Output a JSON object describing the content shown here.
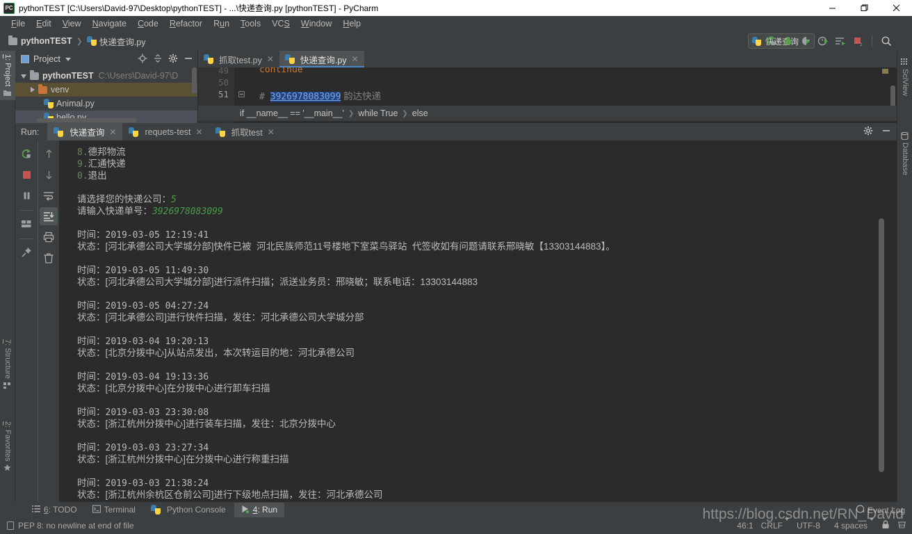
{
  "window": {
    "title": "pythonTEST [C:\\Users\\David-97\\Desktop\\pythonTEST] - ...\\快递查询.py [pythonTEST] - PyCharm",
    "logo_text": "PC",
    "minimize": "—",
    "maximize": "❐",
    "close": "✕"
  },
  "menubar": {
    "items": [
      {
        "label": "File"
      },
      {
        "label": "Edit"
      },
      {
        "label": "View"
      },
      {
        "label": "Navigate"
      },
      {
        "label": "Code"
      },
      {
        "label": "Refactor"
      },
      {
        "label": "Run"
      },
      {
        "label": "Tools"
      },
      {
        "label": "VCS"
      },
      {
        "label": "Window"
      },
      {
        "label": "Help"
      }
    ]
  },
  "navbar": {
    "project_name": "pythonTEST",
    "separator": "❯",
    "file_name": "快递查询.py"
  },
  "run_config": {
    "name": "快递查询",
    "toolbar_icons": [
      "run-icon",
      "debug-icon",
      "coverage-icon",
      "profile-icon",
      "run-with-console-icon",
      "stop-icon",
      "search-everywhere-icon"
    ]
  },
  "left_strip": {
    "tabs": [
      {
        "label": "1: Project",
        "icon": "folder-icon",
        "active": true
      },
      {
        "label": "7: Structure",
        "icon": "structure-icon",
        "active": false
      },
      {
        "label": "2: Favorites",
        "icon": "star-icon",
        "active": false
      }
    ]
  },
  "right_strip": {
    "tabs": [
      {
        "label": "SciView",
        "icon": "grid-icon"
      },
      {
        "label": "Database",
        "icon": "database-icon"
      }
    ]
  },
  "project_window": {
    "title": "Project",
    "actions": [
      "locate-icon",
      "collapse-all-icon",
      "gear-icon",
      "hide-icon"
    ],
    "tree": [
      {
        "label": "pythonTEST",
        "path": "C:\\Users\\David-97\\D",
        "icon": "folder-icon",
        "depth": 0,
        "expanded": true,
        "bold": true,
        "selected": false
      },
      {
        "label": "venv",
        "path": "",
        "icon": "orange-folder-icon",
        "depth": 1,
        "expanded": false,
        "bold": false,
        "selected": true
      },
      {
        "label": "Animal.py",
        "path": "",
        "icon": "python-file-icon",
        "depth": 2,
        "expanded": null,
        "bold": false,
        "selected": false
      },
      {
        "label": "hello.py",
        "path": "",
        "icon": "python-file-icon",
        "depth": 2,
        "expanded": null,
        "bold": false,
        "selected": false
      }
    ]
  },
  "editor": {
    "tabs": [
      {
        "label": "抓取test.py",
        "icon": "python-file-icon",
        "active": false
      },
      {
        "label": "快递查询.py",
        "icon": "python-file-icon",
        "active": true
      }
    ],
    "line_numbers": [
      "49",
      "50",
      "51"
    ],
    "lines": [
      {
        "text": "continue",
        "type": "keyword"
      },
      {
        "text": "",
        "type": "blank"
      },
      {
        "comment_prefix": "# ",
        "selected_token": "3926978083099",
        "trailing": " 韵达快递",
        "type": "comment"
      }
    ],
    "breadcrumbs": [
      "if __name__ == '__main__'",
      "while True",
      "else"
    ],
    "breadcrumb_sep": "❯"
  },
  "run_window": {
    "label": "Run:",
    "tabs": [
      {
        "label": "快递查询",
        "icon": "python-icon",
        "active": true,
        "close": "✕"
      },
      {
        "label": "requets-test",
        "icon": "python-run-icon",
        "active": false,
        "close": "✕"
      },
      {
        "label": "抓取test",
        "icon": "python-icon",
        "active": false,
        "close": "✕"
      }
    ],
    "header_actions": [
      "gear-icon",
      "hide-icon"
    ],
    "sidebar_left": [
      "rerun-icon",
      "stop-icon",
      "pause-icon",
      "layout-icon",
      "pin-icon"
    ],
    "sidebar_right": [
      "up-arrow-icon",
      "down-arrow-icon",
      "soft-wrap-icon",
      "scroll-to-end-icon",
      "print-icon",
      "trash-icon"
    ]
  },
  "console": {
    "menu_lines": [
      {
        "num": "8.",
        "text": "德邦物流"
      },
      {
        "num": "9.",
        "text": "汇通快递"
      },
      {
        "num": "0.",
        "text": "退出"
      }
    ],
    "prompts": [
      {
        "label": "请选择您的快递公司：",
        "value": "5"
      },
      {
        "label": "请输入快递单号：",
        "value": "3926978083099"
      }
    ],
    "time_label": "时间：",
    "status_label": "状态：",
    "entries": [
      {
        "time": "2019-03-05 12:19:41",
        "status": "[河北承德公司大学城分部]快件已被  河北民族师范11号楼地下室菜鸟驿站  代签收如有问题请联系邢晓敏【13303144883】。"
      },
      {
        "time": "2019-03-05 11:49:30",
        "status": "[河北承德公司大学城分部]进行派件扫描；派送业务员：邢晓敏；联系电话：13303144883"
      },
      {
        "time": "2019-03-05 04:27:24",
        "status": "[河北承德公司]进行快件扫描，发往：河北承德公司大学城分部"
      },
      {
        "time": "2019-03-04 19:20:13",
        "status": "[北京分拨中心]从站点发出，本次转运目的地：河北承德公司"
      },
      {
        "time": "2019-03-04 19:13:36",
        "status": "[北京分拨中心]在分拨中心进行卸车扫描"
      },
      {
        "time": "2019-03-03 23:30:08",
        "status": "[浙江杭州分拨中心]进行装车扫描，发往：北京分拨中心"
      },
      {
        "time": "2019-03-03 23:27:34",
        "status": "[浙江杭州分拨中心]在分拨中心进行称重扫描"
      },
      {
        "time": "2019-03-03 21:38:24",
        "status": "[浙江杭州余杭区仓前公司]进行下级地点扫描，发往：河北承德公司"
      }
    ]
  },
  "bottom_strip": {
    "tabs": [
      {
        "label": "6: TODO",
        "icon": "todo-icon",
        "active": false
      },
      {
        "label": "Terminal",
        "icon": "terminal-icon",
        "active": false
      },
      {
        "label": "Python Console",
        "icon": "python-console-icon",
        "active": false
      },
      {
        "label": "4: Run",
        "icon": "run-icon",
        "active": true
      }
    ]
  },
  "status_bar": {
    "message": "PEP 8: no newline at end of file",
    "caret_position": "46:1",
    "line_separator": "CRLF",
    "encoding": "UTF-8",
    "indent": "4 spaces",
    "event_log": "Event Log"
  },
  "watermark": {
    "text": "https://blog.csdn.net/RN_David"
  },
  "colors": {
    "accent_blue": "#4a88c7",
    "panel_bg": "#3c3f41",
    "editor_bg": "#2b2b2b",
    "console_text": "#bbbbbb",
    "user_input_green": "#4a9b4a",
    "selection_blue": "#214283",
    "selected_row": "#5a5134"
  }
}
